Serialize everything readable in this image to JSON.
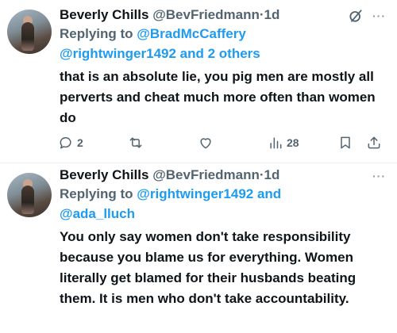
{
  "tweets": [
    {
      "name": "Beverly Chills",
      "handle": "@BevFriedmann",
      "separator": "·",
      "time": "1d",
      "reply_prefix": "Replying to",
      "reply_line1_mention": "@BradMcCaffery",
      "reply_line2": "@rightwinger1492 and 2 others",
      "body": "that is an absolute lie, you pig men are mostly all perverts and cheat much more often than women do",
      "replies": "2",
      "views": "28",
      "more": "···"
    },
    {
      "name": "Beverly Chills",
      "handle": "@BevFriedmann",
      "separator": "·",
      "time": "1d",
      "reply_prefix": "Replying to",
      "reply_line1_mention": "@rightwinger1492 and",
      "reply_line2": "@ada_lluch",
      "body": "You only say women don't take responsibility because you blame us for everything. Women literally get blamed for their husbands beating them. It is men who don't take accountability.",
      "more": "···"
    }
  ],
  "colors": {
    "link": "#1d9bf0",
    "muted": "#536471",
    "text": "#0f1419"
  },
  "icons": [
    "grok-icon",
    "reply-icon",
    "retweet-icon",
    "like-icon",
    "views-icon",
    "bookmark-icon",
    "share-icon"
  ]
}
